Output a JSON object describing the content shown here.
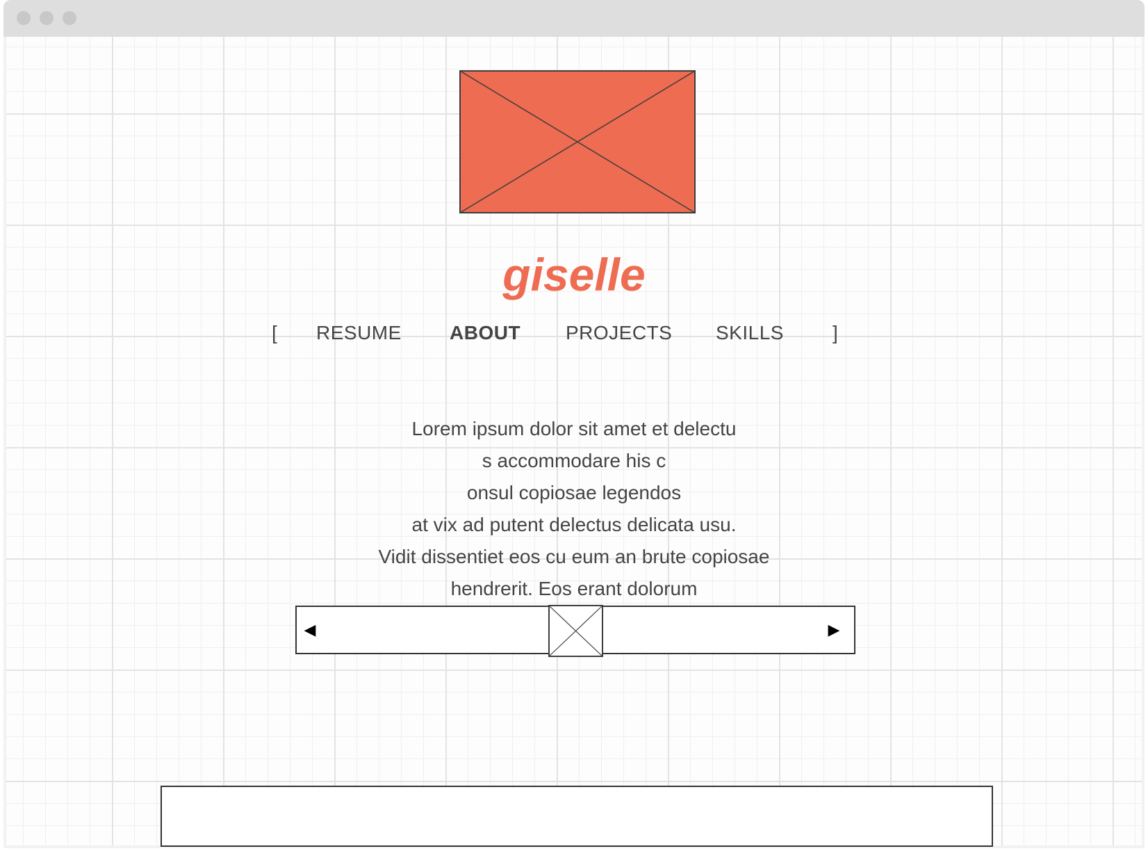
{
  "brand": {
    "name": "giselle",
    "color": "#ee6c51"
  },
  "hero": {
    "icon": "image-placeholder-icon",
    "fill": "#ee6c51"
  },
  "nav": {
    "open_bracket": "[",
    "close_bracket": "]",
    "items": [
      {
        "label": "RESUME",
        "active": false
      },
      {
        "label": "ABOUT",
        "active": true
      },
      {
        "label": "PROJECTS",
        "active": false
      },
      {
        "label": "SKILLS",
        "active": false
      }
    ]
  },
  "about": {
    "lines": [
      "Lorem ipsum dolor sit amet et delectu",
      "s accommodare his c",
      "onsul copiosae legendos",
      "at vix ad putent delectus delicata usu.",
      "Vidit dissentiet eos cu eum an brute copiosae",
      "hendrerit. Eos erant dolorum"
    ]
  },
  "carousel": {
    "prev_icon": "triangle-left-icon",
    "next_icon": "triangle-right-icon",
    "prev_glyph": "◀",
    "next_glyph": "▶",
    "thumb_icon": "image-placeholder-icon"
  },
  "colors": {
    "accent": "#ee6c51",
    "text": "#444444",
    "stroke": "#333333"
  }
}
